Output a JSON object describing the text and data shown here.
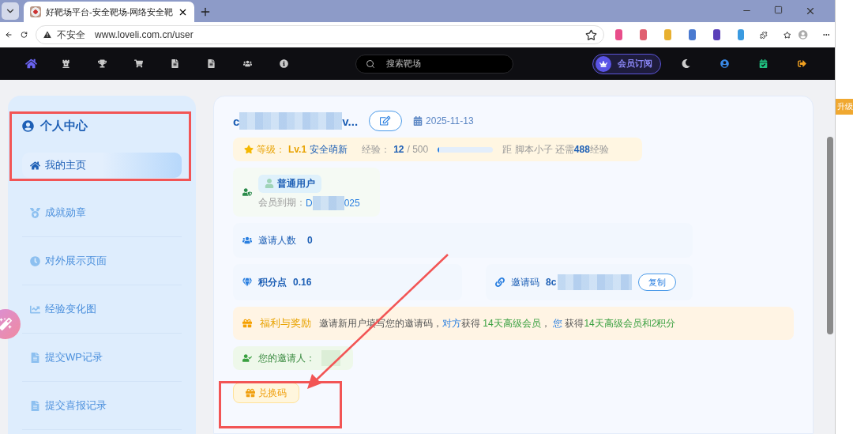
{
  "browser": {
    "tab_title": "好靶场平台-安全靶场-网络安全靶",
    "security_label": "不安全",
    "url": "www.loveli.com.cn/user"
  },
  "navbar": {
    "items": [
      {
        "selected": true
      },
      {
        "selected": false
      },
      {
        "selected": false
      },
      {
        "selected": false
      },
      {
        "selected": false
      },
      {
        "selected": false
      },
      {
        "selected": false
      },
      {
        "selected": false
      }
    ],
    "search_placeholder": "搜索靶场",
    "subscribe": "会员订阅"
  },
  "sidebar": {
    "title": "个人中心",
    "items": [
      {
        "label": "我的主页",
        "selected": true
      },
      {
        "label": "成就勋章",
        "selected": false
      },
      {
        "label": "对外展示页面",
        "selected": false
      },
      {
        "label": "经验变化图",
        "selected": false
      },
      {
        "label": "提交WP记录",
        "selected": false
      },
      {
        "label": "提交喜报记录",
        "selected": false
      }
    ]
  },
  "profile": {
    "username_head": "c",
    "username_tail": "v...",
    "date": "2025-11-13",
    "level": {
      "label": "等级：",
      "level": "Lv.1",
      "title": "安全萌新",
      "exp_label": "经验：",
      "exp": "12",
      "exp_max": "/ 500",
      "progress": {
        "level": 0.02
      },
      "next": "距 脚本小子 还需**488**经验"
    },
    "membership": {
      "role": "普通用户",
      "expiry_label": "会员到期：",
      "expiry_head": "D",
      "expiry_tail": "025"
    },
    "invites": {
      "label": "邀请人数",
      "value": "0"
    },
    "points": {
      "label": "积分点",
      "value": "0.16"
    },
    "invite_code": {
      "label": "邀请码",
      "head": "8c",
      "copy": "复制"
    },
    "reward": {
      "title": "福利与奖励",
      "segments": [
        {
          "kind": "plain",
          "text": "邀请新用户填写您的邀请码，"
        },
        {
          "kind": "blue",
          "text": "对方"
        },
        {
          "kind": "plain",
          "text": "获得 "
        },
        {
          "kind": "green",
          "text": "14天高级会员"
        },
        {
          "kind": "plain",
          "text": "，  "
        },
        {
          "kind": "blue",
          "text": "您"
        },
        {
          "kind": "plain",
          "text": " 获得"
        },
        {
          "kind": "green",
          "text": "14天高级会员和2积分"
        }
      ]
    },
    "inviter": {
      "label": "您的邀请人："
    },
    "redeem": "兑换码"
  },
  "side_window": {
    "tag": "升级"
  }
}
